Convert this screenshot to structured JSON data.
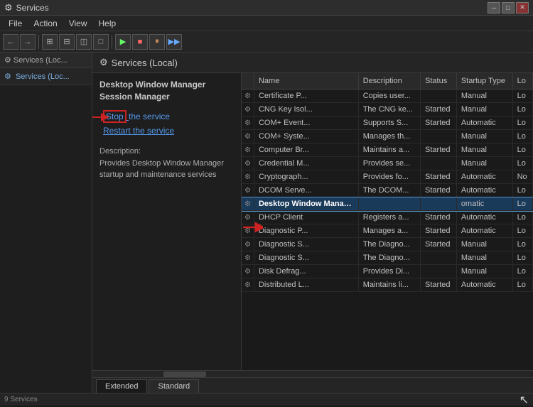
{
  "window": {
    "title": "Services",
    "icon": "⚙",
    "controls": [
      "─",
      "□",
      "✕"
    ]
  },
  "menu": {
    "items": [
      "File",
      "Action",
      "View",
      "Help"
    ]
  },
  "toolbar": {
    "buttons": [
      "←",
      "→",
      "□",
      "▦",
      "▧",
      "□",
      "□",
      "▶",
      "■",
      "⏸",
      "▶▶"
    ]
  },
  "sidebar": {
    "header": "Services (Loc...",
    "tree_item": "Services (Loc..."
  },
  "content_header": {
    "icon": "⚙",
    "title": "Services (Local)"
  },
  "detail_panel": {
    "title": "Desktop Window Manager\nSession Manager",
    "actions": [
      {
        "id": "stop",
        "label": "Stop",
        "underline": true,
        "boxed": true
      },
      {
        "id": "stop_suffix",
        "label": " the service"
      },
      {
        "id": "restart",
        "label": "Restart the service"
      }
    ],
    "description_label": "Description:",
    "description_text": "Provides Desktop Window Manager startup and maintenance services"
  },
  "table": {
    "columns": [
      "",
      "Name",
      "Description",
      "Status",
      "Startup Type",
      "Lo"
    ],
    "rows": [
      {
        "icon": "⚙",
        "name": "Certificate P...",
        "desc": "Copies user...",
        "status": "",
        "startup": "Manual",
        "lo": "Lo"
      },
      {
        "icon": "⚙",
        "name": "CNG Key Isol...",
        "desc": "The CNG ke...",
        "status": "Started",
        "startup": "Manual",
        "lo": "Lo"
      },
      {
        "icon": "⚙",
        "name": "COM+ Event...",
        "desc": "Supports S...",
        "status": "Started",
        "startup": "Automatic",
        "lo": "Lo"
      },
      {
        "icon": "⚙",
        "name": "COM+ Syste...",
        "desc": "Manages th...",
        "status": "",
        "startup": "Manual",
        "lo": "Lo"
      },
      {
        "icon": "⚙",
        "name": "Computer Br...",
        "desc": "Maintains a...",
        "status": "Started",
        "startup": "Manual",
        "lo": "Lo"
      },
      {
        "icon": "⚙",
        "name": "Credential M...",
        "desc": "Provides se...",
        "status": "",
        "startup": "Manual",
        "lo": "Lo"
      },
      {
        "icon": "⚙",
        "name": "Cryptograph...",
        "desc": "Provides fo...",
        "status": "Started",
        "startup": "Automatic",
        "lo": "No"
      },
      {
        "icon": "⚙",
        "name": "DCOM Serve...",
        "desc": "The DCOM...",
        "status": "Started",
        "startup": "Automatic",
        "lo": "Lo"
      },
      {
        "icon": "⚙",
        "name": "Desktop Window Manager Session Manager",
        "desc": "",
        "status": "",
        "startup": "omatic",
        "lo": "Lo",
        "selected": true
      },
      {
        "icon": "⚙",
        "name": "DHCP Client",
        "desc": "Registers a...",
        "status": "Started",
        "startup": "Automatic",
        "lo": "Lo"
      },
      {
        "icon": "⚙",
        "name": "Diagnostic P...",
        "desc": "Manages a...",
        "status": "Started",
        "startup": "Automatic",
        "lo": "Lo"
      },
      {
        "icon": "⚙",
        "name": "Diagnostic S...",
        "desc": "The Diagno...",
        "status": "Started",
        "startup": "Manual",
        "lo": "Lo"
      },
      {
        "icon": "⚙",
        "name": "Diagnostic S...",
        "desc": "The Diagno...",
        "status": "",
        "startup": "Manual",
        "lo": "Lo"
      },
      {
        "icon": "⚙",
        "name": "Disk Defrag...",
        "desc": "Provides Di...",
        "status": "",
        "startup": "Manual",
        "lo": "Lo"
      },
      {
        "icon": "⚙",
        "name": "Distributed L...",
        "desc": "Maintains li...",
        "status": "Started",
        "startup": "Automatic",
        "lo": "Lo"
      }
    ]
  },
  "tabs": [
    {
      "id": "extended",
      "label": "Extended",
      "active": true
    },
    {
      "id": "standard",
      "label": "Standard",
      "active": false
    }
  ],
  "status_bar": {
    "count": "9 Services"
  },
  "colors": {
    "selected_row": "#1a3a5a",
    "accent_blue": "#5599ee",
    "annotation_red": "#cc2222"
  }
}
